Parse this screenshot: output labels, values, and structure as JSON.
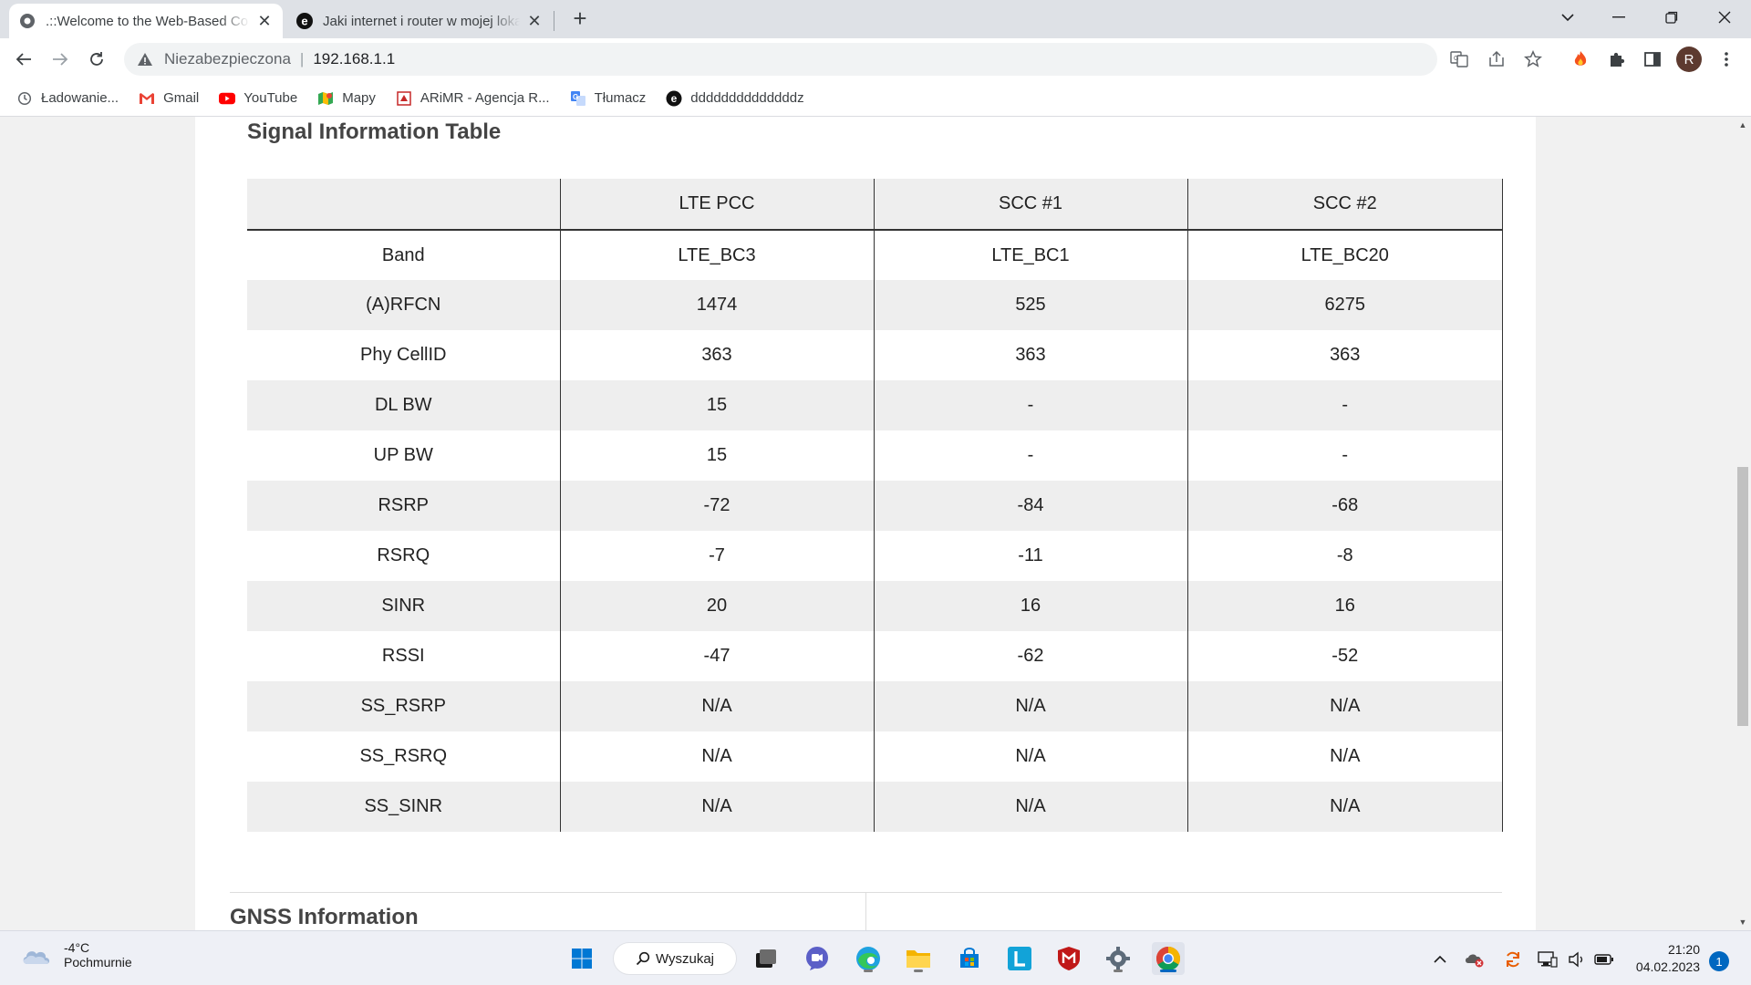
{
  "browser": {
    "tabs": [
      {
        "title": ".::Welcome to the Web-Based Co",
        "active": true
      },
      {
        "title": "Jaki internet i router w mojej loka",
        "active": false
      }
    ],
    "address": {
      "security_label": "Niezabezpieczona",
      "url": "192.168.1.1"
    },
    "profile_initial": "R",
    "bookmarks": [
      {
        "label": "Ładowanie...",
        "icon": "history-icon"
      },
      {
        "label": "Gmail",
        "icon": "gmail-icon"
      },
      {
        "label": "YouTube",
        "icon": "youtube-icon"
      },
      {
        "label": "Mapy",
        "icon": "maps-icon"
      },
      {
        "label": "ARiMR - Agencja R...",
        "icon": "arimr-icon"
      },
      {
        "label": "Tłumacz",
        "icon": "translate-icon"
      },
      {
        "label": "ddddddddddddddz",
        "icon": "edge-icon"
      }
    ]
  },
  "page": {
    "signal_title": "Signal Information Table",
    "table": {
      "headers": [
        "",
        "LTE PCC",
        "SCC #1",
        "SCC #2"
      ],
      "rows": [
        [
          "Band",
          "LTE_BC3",
          "LTE_BC1",
          "LTE_BC20"
        ],
        [
          "(A)RFCN",
          "1474",
          "525",
          "6275"
        ],
        [
          "Phy CellID",
          "363",
          "363",
          "363"
        ],
        [
          "DL BW",
          "15",
          "-",
          "-"
        ],
        [
          "UP BW",
          "15",
          "-",
          "-"
        ],
        [
          "RSRP",
          "-72",
          "-84",
          "-68"
        ],
        [
          "RSRQ",
          "-7",
          "-11",
          "-8"
        ],
        [
          "SINR",
          "20",
          "16",
          "16"
        ],
        [
          "RSSI",
          "-47",
          "-62",
          "-52"
        ],
        [
          "SS_RSRP",
          "N/A",
          "N/A",
          "N/A"
        ],
        [
          "SS_RSRQ",
          "N/A",
          "N/A",
          "N/A"
        ],
        [
          "SS_SINR",
          "N/A",
          "N/A",
          "N/A"
        ]
      ]
    },
    "gnss_title": "GNSS Information"
  },
  "taskbar": {
    "weather": {
      "temp": "-4°C",
      "condition": "Pochmurnie"
    },
    "search_label": "Wyszukaj",
    "time": "21:20",
    "date": "04.02.2023",
    "notifications": "1"
  }
}
